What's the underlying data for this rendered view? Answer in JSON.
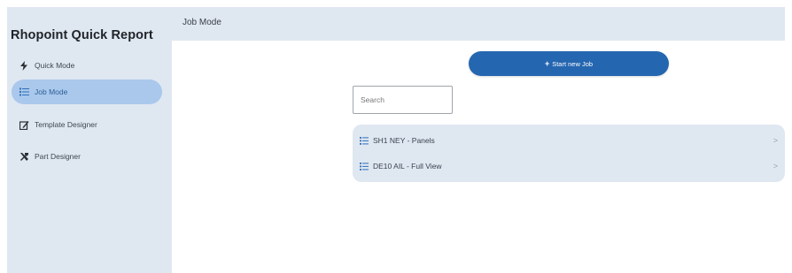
{
  "sidebar": {
    "app_title": "Rhopoint Quick Report",
    "items": [
      {
        "label": "Quick Mode",
        "icon": "lightning-icon",
        "active": false
      },
      {
        "label": "Job Mode",
        "icon": "list-icon",
        "active": true
      },
      {
        "label": "Template Designer",
        "icon": "edit-icon",
        "active": false
      },
      {
        "label": "Part Designer",
        "icon": "tools-icon",
        "active": false
      }
    ]
  },
  "header": {
    "title": "Job Mode"
  },
  "main": {
    "start_button": {
      "plus": "+",
      "label": "Start new Job"
    },
    "search": {
      "placeholder": "Search",
      "value": ""
    },
    "jobs": [
      {
        "label": "SH1 NEY - Panels",
        "icon": "list-icon",
        "chevron": ">"
      },
      {
        "label": "DE10 AIL - Full View",
        "icon": "list-icon",
        "chevron": ">"
      }
    ]
  },
  "colors": {
    "panel": "#dfe7f1",
    "active_nav": "#a9c8ec",
    "accent": "#2566b0"
  }
}
